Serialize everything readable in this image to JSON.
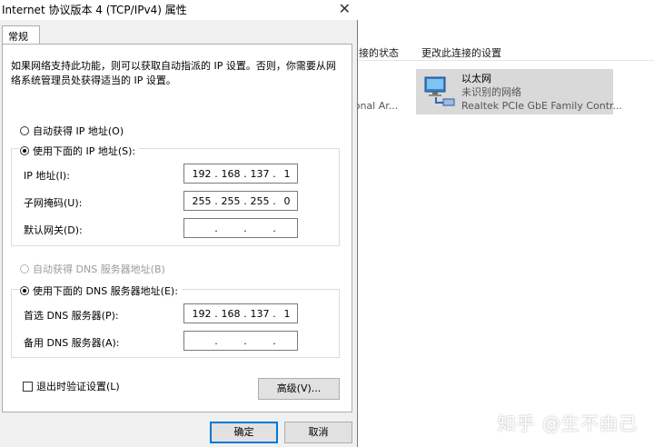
{
  "dialog": {
    "title": "Internet 协议版本 4 (TCP/IPv4) 属性",
    "tab": "常规",
    "description": "如果网络支持此功能，则可以获取自动指派的 IP 设置。否则，你需要从网络系统管理员处获得适当的 IP 设置。",
    "auto_ip_label": "自动获得 IP 地址(O)",
    "manual_ip_label": "使用下面的 IP 地址(S):",
    "ip_label": "IP 地址(I):",
    "ip_value": [
      "192",
      "168",
      "137",
      "1"
    ],
    "mask_label": "子网掩码(U):",
    "mask_value": [
      "255",
      "255",
      "255",
      "0"
    ],
    "gateway_label": "默认网关(D):",
    "gateway_value": [
      "",
      "",
      "",
      ""
    ],
    "auto_dns_label": "自动获得 DNS 服务器地址(B)",
    "manual_dns_label": "使用下面的 DNS 服务器地址(E):",
    "pref_dns_label": "首选 DNS 服务器(P):",
    "pref_dns_value": [
      "192",
      "168",
      "137",
      "1"
    ],
    "alt_dns_label": "备用 DNS 服务器(A):",
    "alt_dns_value": [
      "",
      "",
      "",
      ""
    ],
    "validate_label": "退出时验证设置(L)",
    "advanced_label": "高级(V)...",
    "ok_label": "确定",
    "cancel_label": "取消"
  },
  "background": {
    "toolbar": [
      "接的状态",
      "更改此连接的设置"
    ],
    "left_item": "sonal Ar...",
    "adapter": {
      "name": "以太网",
      "status": "未识别的网络",
      "device": "Realtek PCIe GbE Family Contr..."
    }
  },
  "watermark": "知乎 @生不由己",
  "colors": {
    "dialog_bg": "#f0f0f0",
    "selection_bg": "#d9d9d9",
    "default_button_border": "#0078d7"
  }
}
